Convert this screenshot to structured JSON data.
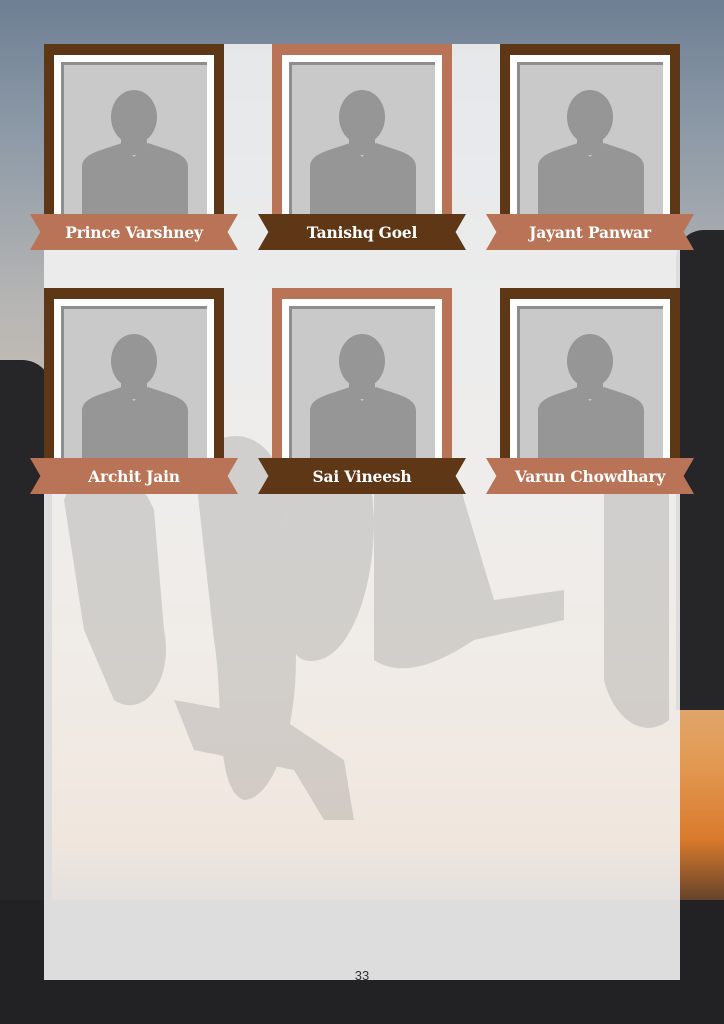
{
  "people": [
    {
      "name": "Prince Varshney",
      "frame": "dark",
      "ribbon": "light"
    },
    {
      "name": "Tanishq Goel",
      "frame": "light",
      "ribbon": "dark"
    },
    {
      "name": "Jayant Panwar",
      "frame": "dark",
      "ribbon": "light"
    },
    {
      "name": "Archit Jain",
      "frame": "dark",
      "ribbon": "light"
    },
    {
      "name": "Sai Vineesh",
      "frame": "light",
      "ribbon": "dark"
    },
    {
      "name": "Varun Chowdhary",
      "frame": "dark",
      "ribbon": "light"
    }
  ],
  "page_number": "33",
  "colors": {
    "dark_brown": "#5e3717",
    "terracotta": "#b97457",
    "placeholder_gray": "#c9c9c9"
  },
  "icon": "person-placeholder-icon"
}
